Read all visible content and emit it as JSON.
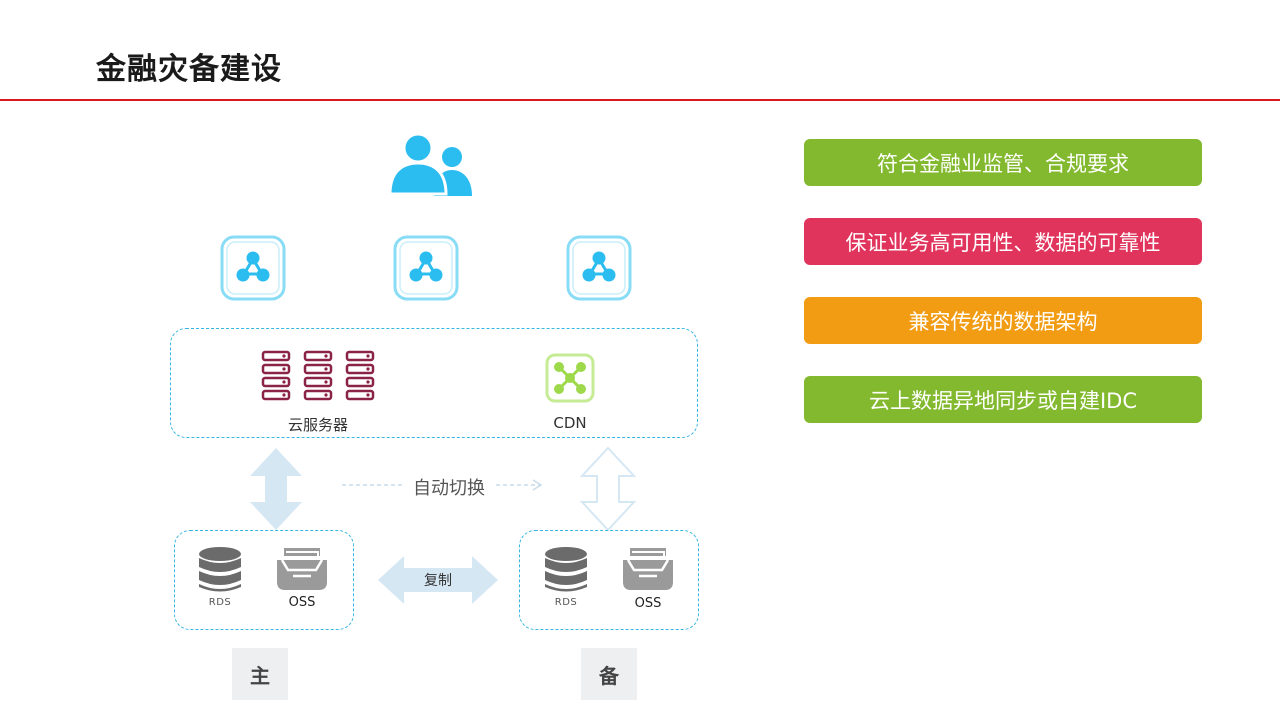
{
  "title": "金融灾备建设",
  "colors": {
    "accent_rule": "#d7191f",
    "icon_blue": "#2bbdf0",
    "server_red": "#8a2346",
    "cdn_green": "#9ed84b",
    "dashed_border": "#35b6e3",
    "arrow_fill": "#d6e7f4",
    "db_gray": "#6b6b6b"
  },
  "diagram": {
    "users_icon": "users-icon",
    "network_nodes": [
      "share-node-icon",
      "share-node-icon",
      "share-node-icon"
    ],
    "cloud": {
      "server_label": "云服务器",
      "cdn_label": "CDN"
    },
    "switch_label": "自动切换",
    "replicate_label": "复制",
    "main": {
      "rds_label": "RDS",
      "oss_label": "OSS",
      "tag": "主"
    },
    "backup": {
      "rds_label": "RDS",
      "oss_label": "OSS",
      "tag": "备"
    }
  },
  "features": [
    {
      "text": "符合金融业监管、合规要求",
      "color": "#82b92e"
    },
    {
      "text": "保证业务高可用性、数据的可靠性",
      "color": "#e1345c"
    },
    {
      "text": "兼容传统的数据架构",
      "color": "#f29c14"
    },
    {
      "text": "云上数据异地同步或自建IDC",
      "color": "#82b92e"
    }
  ]
}
